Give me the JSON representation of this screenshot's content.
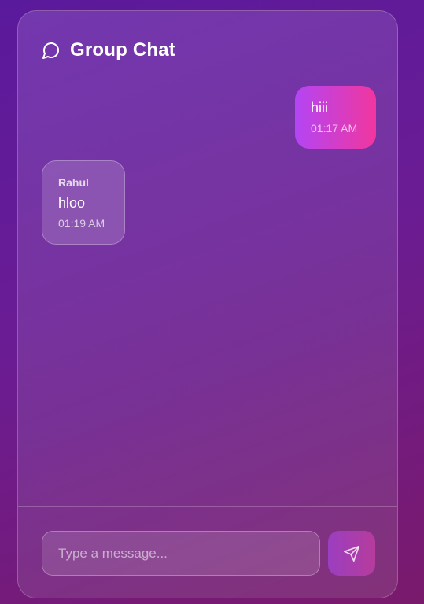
{
  "header": {
    "title": "Group Chat",
    "icon": "chat-bubble-icon"
  },
  "messages": [
    {
      "type": "sent",
      "text": "hiii",
      "time": "01:17 AM"
    },
    {
      "type": "received",
      "sender": "Rahul",
      "text": "hloo",
      "time": "01:19 AM"
    }
  ],
  "composer": {
    "placeholder": "Type a message...",
    "value": "",
    "send_icon": "send-icon"
  },
  "colors": {
    "sent_bubble_start": "#b345f4",
    "sent_bubble_end": "#f1369e",
    "background": "#6a1c94"
  }
}
